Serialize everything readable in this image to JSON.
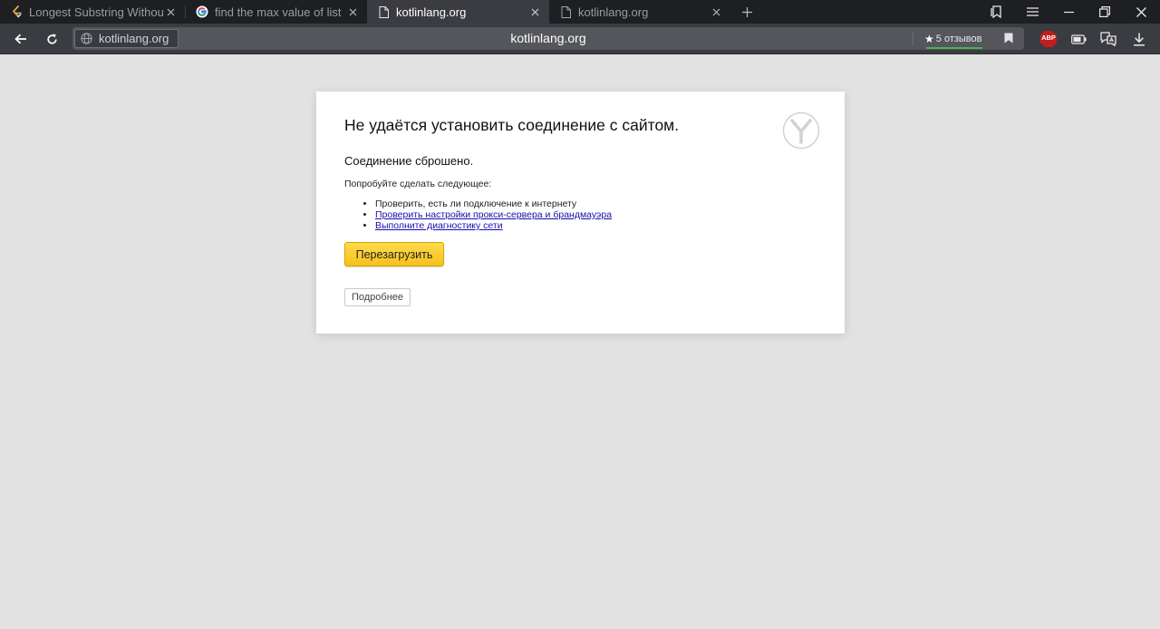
{
  "tabs": [
    {
      "title": "Longest Substring Without Repeating Characters",
      "icon": "leetcode-icon",
      "active": false
    },
    {
      "title": "find the max value of list kotlin",
      "icon": "google-icon",
      "active": false
    },
    {
      "title": "kotlinlang.org",
      "icon": "page-icon",
      "active": true
    },
    {
      "title": "kotlinlang.org",
      "icon": "page-icon",
      "active": false
    }
  ],
  "address_bar": {
    "host": "kotlinlang.org",
    "page_title": "kotlinlang.org",
    "reviews_label": "5 отзывов"
  },
  "extensions": {
    "adblock_label": "ABP"
  },
  "error_page": {
    "title": "Не удаётся установить соединение с сайтом.",
    "subtitle": "Соединение сброшено.",
    "try_label": "Попробуйте сделать следующее:",
    "suggestions": [
      {
        "text": "Проверить, есть ли подключение к интернету",
        "link": false
      },
      {
        "text": "Проверить настройки прокси-сервера и брандмауэра",
        "link": true
      },
      {
        "text": "Выполните диагностику сети",
        "link": true
      }
    ],
    "reload_label": "Перезагрузить",
    "details_label": "Подробнее"
  },
  "colors": {
    "reload_button": "#ffd633",
    "page_background": "#e2e2e2",
    "tabstrip": "#1e1f22",
    "toolbar": "#3b3c41",
    "link": "#1a0dab"
  }
}
